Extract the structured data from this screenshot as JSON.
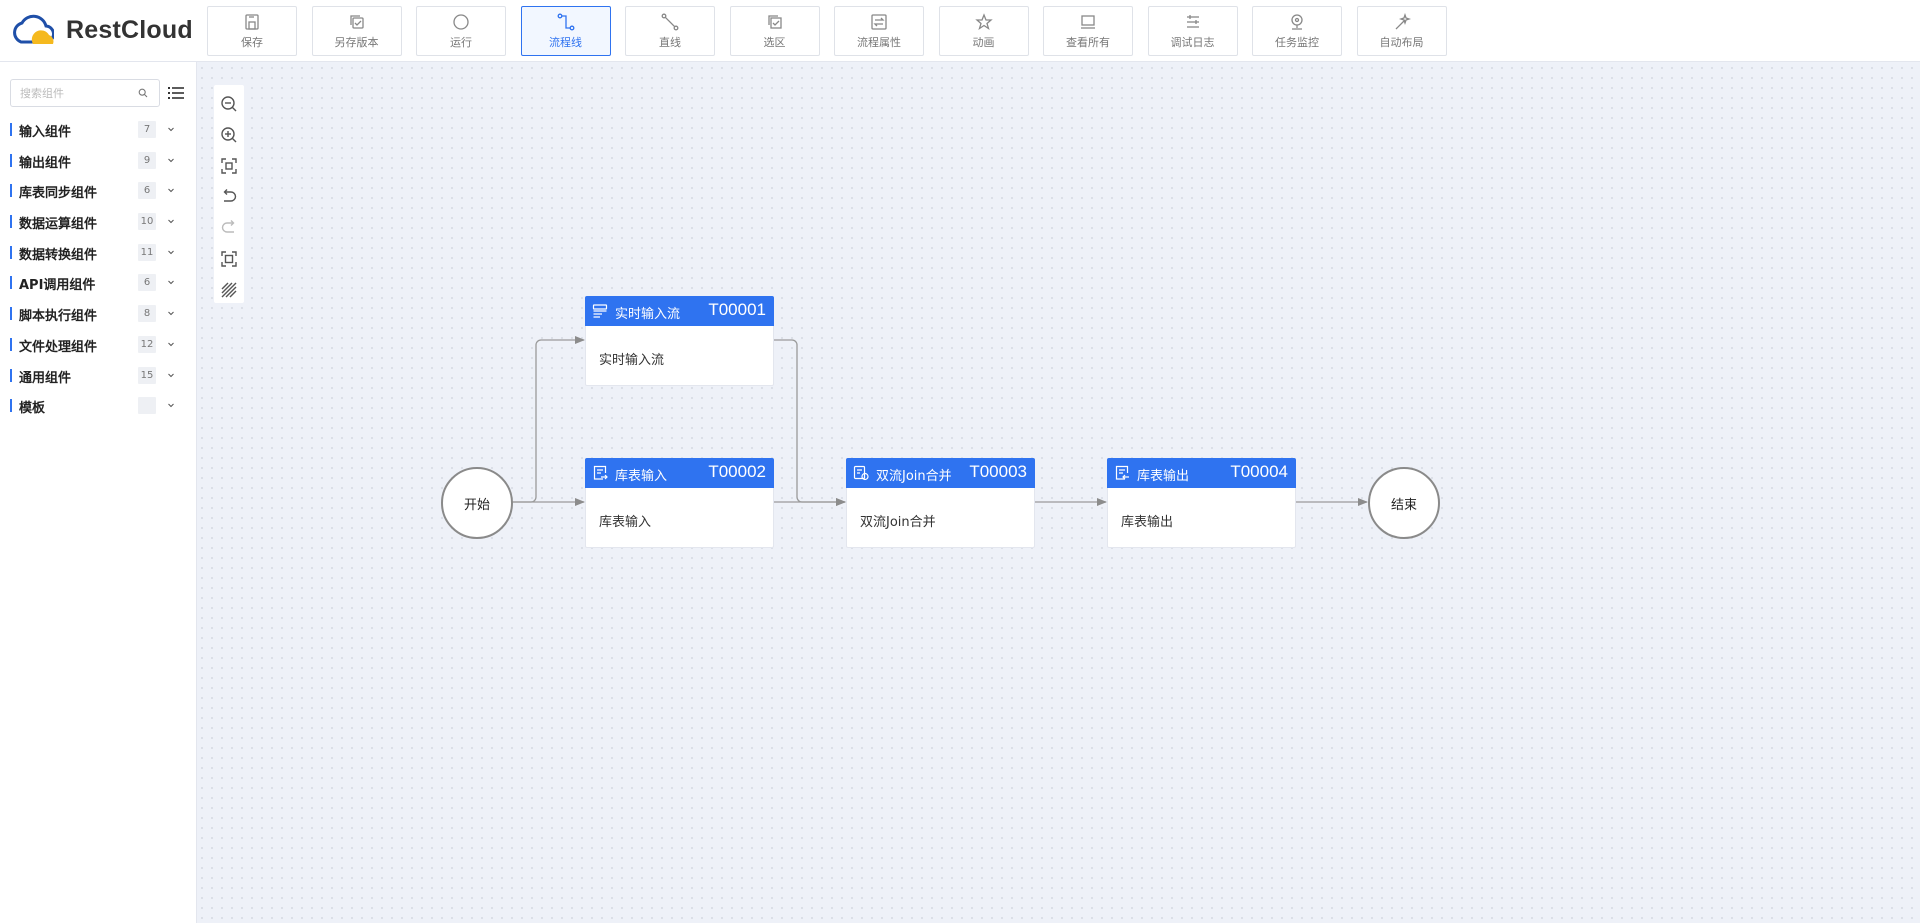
{
  "app": {
    "brand": "RestCloud",
    "accent_color": "#2f73f0"
  },
  "toolbar": [
    {
      "label": "保存",
      "icon": "save-icon"
    },
    {
      "label": "另存版本",
      "icon": "save-as-icon"
    },
    {
      "label": "运行",
      "icon": "run-icon"
    },
    {
      "label": "流程线",
      "icon": "flow-line-icon",
      "active": true
    },
    {
      "label": "直线",
      "icon": "straight-line-icon"
    },
    {
      "label": "选区",
      "icon": "select-area-icon"
    },
    {
      "label": "流程属性",
      "icon": "flow-properties-icon"
    },
    {
      "label": "动画",
      "icon": "animation-icon"
    },
    {
      "label": "查看所有",
      "icon": "view-all-icon"
    },
    {
      "label": "调试日志",
      "icon": "debug-log-icon"
    },
    {
      "label": "任务监控",
      "icon": "task-monitor-icon"
    },
    {
      "label": "自动布局",
      "icon": "auto-layout-icon"
    }
  ],
  "sidebar": {
    "search": {
      "placeholder": "搜索组件",
      "value": ""
    },
    "categories": [
      {
        "label": "输入组件",
        "count": "7"
      },
      {
        "label": "输出组件",
        "count": "9"
      },
      {
        "label": "库表同步组件",
        "count": "6"
      },
      {
        "label": "数据运算组件",
        "count": "10"
      },
      {
        "label": "数据转换组件",
        "count": "11"
      },
      {
        "label": "API调用组件",
        "count": "6"
      },
      {
        "label": "脚本执行组件",
        "count": "8"
      },
      {
        "label": "文件处理组件",
        "count": "12"
      },
      {
        "label": "通用组件",
        "count": "15"
      },
      {
        "label": "模板",
        "count": ""
      }
    ]
  },
  "zoom_tools": [
    "zoom-out-icon",
    "zoom-in-icon",
    "fit-view-icon",
    "undo-icon",
    "redo-icon",
    "full-screen-icon",
    "grid-icon"
  ],
  "flow": {
    "start": "开始",
    "end": "结束",
    "tasks": [
      {
        "name": "实时输入流",
        "id": "T00001",
        "body": "实时输入流",
        "icon": "stream-input-icon"
      },
      {
        "name": "库表输入",
        "id": "T00002",
        "body": "库表输入",
        "icon": "table-input-icon"
      },
      {
        "name": "双流Join合并",
        "id": "T00003",
        "body": "双流Join合并",
        "icon": "join-icon"
      },
      {
        "name": "库表输出",
        "id": "T00004",
        "body": "库表输出",
        "icon": "table-output-icon"
      }
    ]
  }
}
